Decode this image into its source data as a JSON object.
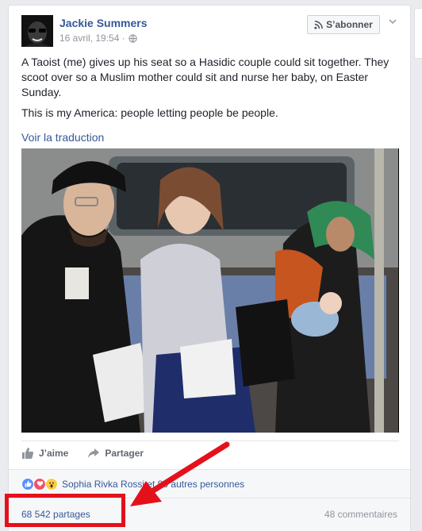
{
  "post": {
    "author": "Jackie Summers",
    "timestamp": "16 avril, 19:54 ·",
    "follow_label": "S’abonner",
    "paragraph1": "A Taoist (me) gives up his seat so a Hasidic couple could sit together. They scoot over so a Muslim mother could sit and nurse her baby, on Easter Sunday.",
    "paragraph2": "This is my America: people letting people be people.",
    "translate_link": "Voir la traduction"
  },
  "actions": {
    "like_label": "J’aime",
    "share_label": "Partager"
  },
  "reactions": {
    "text": "Sophia Rivka Rossi et 90 autres personnes",
    "icons": [
      "like-reaction-icon",
      "love-reaction-icon",
      "wow-reaction-icon"
    ]
  },
  "stats": {
    "shares": "68 542 partages",
    "comments": "48 commentaires"
  },
  "colors": {
    "link": "#365899",
    "highlight": "#e4111b"
  }
}
